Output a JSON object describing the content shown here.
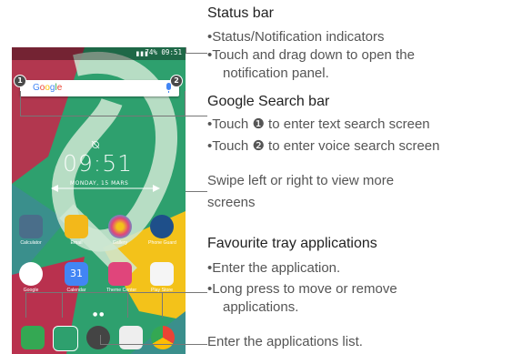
{
  "phone": {
    "status_text": "74% 09:51",
    "search_logo": "Google",
    "badge_1": "1",
    "badge_2": "2",
    "clock": "09:51",
    "date": "MONDAY, 15 MARS",
    "apps_row1": [
      "Calculator",
      "Email",
      "Gallery",
      "Phone Guard"
    ],
    "apps_row2": [
      "Google",
      "Calendar",
      "Theme Center",
      "Play Store"
    ],
    "calendar_number": "31",
    "colors": {
      "background_green": "#2ea06e",
      "teal": "#3a8f8c",
      "yellow": "#f3c21a",
      "red": "#c9254a"
    }
  },
  "annotations": {
    "status_bar": {
      "title": "Status bar",
      "items": [
        "•Status/Notification indicators",
        "•Touch and drag down to open the",
        "notification panel."
      ]
    },
    "google_search": {
      "title": "Google Search bar",
      "items": [
        "•Touch ❶ to enter text search screen",
        "•Touch ❷ to enter voice search screen"
      ]
    },
    "swipe": {
      "items": [
        "Swipe left or right to view more",
        "screens"
      ]
    },
    "favourite": {
      "title": "Favourite tray applications",
      "items": [
        "•Enter the application.",
        "•Long press to move or remove",
        "applications."
      ]
    },
    "app_list": {
      "items": [
        "Enter the applications list."
      ]
    }
  }
}
